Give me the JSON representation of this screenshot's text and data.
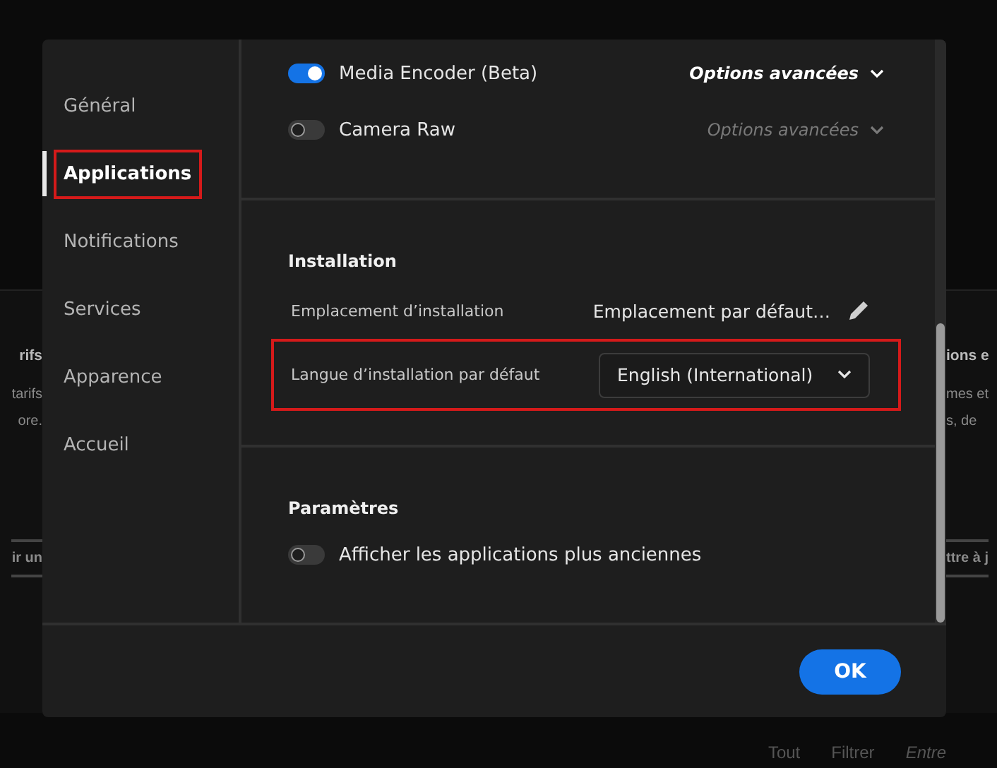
{
  "background": {
    "left_texts": [
      {
        "text": "rifs",
        "kind": "heading"
      },
      {
        "text": "tarifs",
        "kind": "body"
      },
      {
        "text": "ore.",
        "kind": "body"
      },
      {
        "text": "ir un",
        "kind": "button"
      }
    ],
    "right_texts": [
      {
        "text": "ions e",
        "kind": "heading"
      },
      {
        "text": "mes et",
        "kind": "body"
      },
      {
        "text": "s, de",
        "kind": "body"
      },
      {
        "text": "ttre à j",
        "kind": "button"
      }
    ],
    "bottom_texts": [
      "Tout",
      "Filtrer",
      "Entre"
    ]
  },
  "sidebar": {
    "items": [
      {
        "label": "Général",
        "selected": false,
        "highlighted": false
      },
      {
        "label": "Applications",
        "selected": true,
        "highlighted": true
      },
      {
        "label": "Notifications",
        "selected": false,
        "highlighted": false
      },
      {
        "label": "Services",
        "selected": false,
        "highlighted": false
      },
      {
        "label": "Apparence",
        "selected": false,
        "highlighted": false
      },
      {
        "label": "Accueil",
        "selected": false,
        "highlighted": false
      }
    ]
  },
  "apps": [
    {
      "name": "Media Encoder (Beta)",
      "on": true,
      "options": "Options avancées",
      "options_disabled": false
    },
    {
      "name": "Camera Raw",
      "on": false,
      "options": "Options avancées",
      "options_disabled": true
    }
  ],
  "installation": {
    "title": "Installation",
    "rows": [
      {
        "kind": "path",
        "label": "Emplacement d’installation",
        "value": "Emplacement par défaut…",
        "highlighted": false
      },
      {
        "kind": "dropdown",
        "label": "Langue d’installation par défaut",
        "value": "English (International)",
        "highlighted": true
      }
    ]
  },
  "parametres": {
    "title": "Paramètres",
    "toggles": [
      {
        "label": "Afficher les applications plus anciennes",
        "on": false
      }
    ]
  },
  "footer": {
    "ok": "OK"
  }
}
